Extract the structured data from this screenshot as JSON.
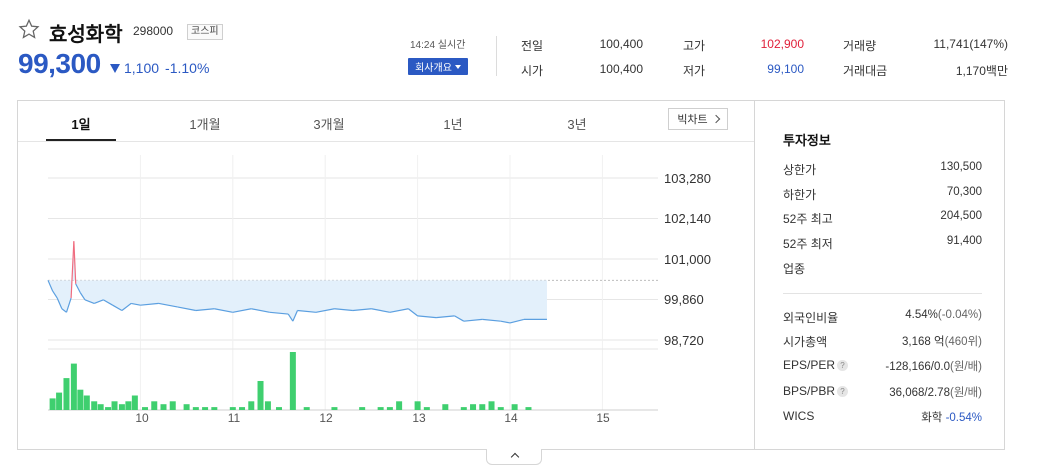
{
  "header": {
    "name": "효성화학",
    "code": "298000",
    "market": "코스피",
    "price": "99,300",
    "change": "1,100",
    "change_pct": "-1.10%",
    "realtime": "14:24 실시간",
    "company_btn": "회사개요"
  },
  "quote": {
    "prev_label": "전일",
    "prev_value": "100,400",
    "high_label": "고가",
    "high_value": "102,900",
    "volume_label": "거래량",
    "volume_value": "11,741(147%)",
    "open_label": "시가",
    "open_value": "100,400",
    "low_label": "저가",
    "low_value": "99,100",
    "amount_label": "거래대금",
    "amount_value": "1,170백만"
  },
  "tabs": [
    "1일",
    "1개월",
    "3개월",
    "1년",
    "3년"
  ],
  "bigchart_label": "빅차트",
  "chart_data": {
    "type": "area",
    "y_ticks": [
      "103,280",
      "102,140",
      "101,000",
      "99,860",
      "98,720"
    ],
    "ylim": [
      98720,
      103280
    ],
    "x_ticks": [
      "10",
      "11",
      "12",
      "13",
      "14",
      "15"
    ],
    "reference_price": 100400,
    "price_series": [
      [
        9.0,
        100400
      ],
      [
        9.05,
        100100
      ],
      [
        9.1,
        99900
      ],
      [
        9.15,
        99600
      ],
      [
        9.2,
        99500
      ],
      [
        9.25,
        99900
      ],
      [
        9.28,
        101500
      ],
      [
        9.3,
        100300
      ],
      [
        9.35,
        100050
      ],
      [
        9.4,
        99850
      ],
      [
        9.5,
        99750
      ],
      [
        9.6,
        99850
      ],
      [
        9.7,
        99700
      ],
      [
        9.8,
        99550
      ],
      [
        9.9,
        99750
      ],
      [
        10.0,
        99700
      ],
      [
        10.2,
        99750
      ],
      [
        10.4,
        99650
      ],
      [
        10.6,
        99550
      ],
      [
        10.8,
        99600
      ],
      [
        11.0,
        99500
      ],
      [
        11.2,
        99600
      ],
      [
        11.4,
        99500
      ],
      [
        11.6,
        99450
      ],
      [
        11.65,
        99250
      ],
      [
        11.7,
        99550
      ],
      [
        11.9,
        99500
      ],
      [
        12.1,
        99600
      ],
      [
        12.3,
        99550
      ],
      [
        12.5,
        99600
      ],
      [
        12.7,
        99500
      ],
      [
        12.9,
        99600
      ],
      [
        13.0,
        99400
      ],
      [
        13.2,
        99350
      ],
      [
        13.4,
        99400
      ],
      [
        13.5,
        99250
      ],
      [
        13.7,
        99300
      ],
      [
        13.9,
        99250
      ],
      [
        14.0,
        99200
      ],
      [
        14.15,
        99300
      ],
      [
        14.4,
        99300
      ]
    ],
    "volume_series": [
      [
        9.05,
        20
      ],
      [
        9.12,
        30
      ],
      [
        9.2,
        55
      ],
      [
        9.28,
        80
      ],
      [
        9.35,
        35
      ],
      [
        9.42,
        25
      ],
      [
        9.5,
        15
      ],
      [
        9.57,
        10
      ],
      [
        9.65,
        5
      ],
      [
        9.72,
        15
      ],
      [
        9.8,
        10
      ],
      [
        9.87,
        15
      ],
      [
        9.94,
        25
      ],
      [
        10.05,
        5
      ],
      [
        10.15,
        15
      ],
      [
        10.25,
        10
      ],
      [
        10.35,
        15
      ],
      [
        10.5,
        10
      ],
      [
        10.6,
        5
      ],
      [
        10.7,
        5
      ],
      [
        10.8,
        5
      ],
      [
        11.0,
        5
      ],
      [
        11.1,
        5
      ],
      [
        11.2,
        15
      ],
      [
        11.3,
        50
      ],
      [
        11.38,
        15
      ],
      [
        11.5,
        5
      ],
      [
        11.65,
        100
      ],
      [
        11.8,
        5
      ],
      [
        12.1,
        5
      ],
      [
        12.4,
        5
      ],
      [
        12.6,
        5
      ],
      [
        12.7,
        5
      ],
      [
        12.8,
        15
      ],
      [
        13.0,
        15
      ],
      [
        13.1,
        5
      ],
      [
        13.3,
        10
      ],
      [
        13.5,
        5
      ],
      [
        13.6,
        10
      ],
      [
        13.7,
        10
      ],
      [
        13.8,
        15
      ],
      [
        13.9,
        5
      ],
      [
        14.05,
        10
      ],
      [
        14.2,
        5
      ]
    ]
  },
  "side": {
    "title": "투자정보",
    "upper_label": "상한가",
    "upper_value": "130,500",
    "lower_label": "하한가",
    "lower_value": "70,300",
    "high52_label": "52주 최고",
    "high52_value": "204,500",
    "low52_label": "52주 최저",
    "low52_value": "91,400",
    "sector_label": "업종",
    "foreign_label": "외국인비율",
    "foreign_value": "4.54%",
    "foreign_extra": "(-0.04%)",
    "cap_label": "시가총액",
    "cap_value": "3,168 억",
    "cap_extra": "(460위)",
    "eps_label": "EPS/PER",
    "eps_value": "-128,166/0.0",
    "eps_extra": "(원/배)",
    "bps_label": "BPS/PBR",
    "bps_value": "36,068/2.78",
    "bps_extra": "(원/배)",
    "wics_label": "WICS",
    "wics_value": "화학",
    "wics_change": "-0.54%"
  },
  "colors": {
    "up": "#e0203a",
    "down": "#2b59c3",
    "volume": "#3fcf6f",
    "area": "#e3f0fb",
    "line": "#5b9fe0"
  }
}
